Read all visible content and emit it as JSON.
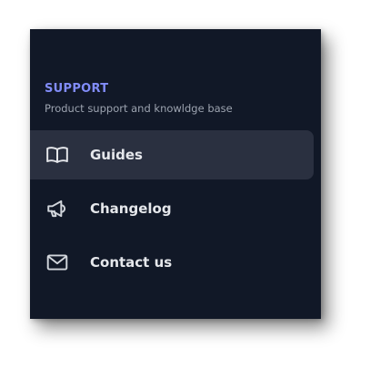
{
  "section": {
    "title": "SUPPORT",
    "subtitle": "Product support and knowldge base"
  },
  "nav": {
    "items": [
      {
        "label": "Guides",
        "icon": "book-open-icon",
        "active": true
      },
      {
        "label": "Changelog",
        "icon": "megaphone-icon",
        "active": false
      },
      {
        "label": "Contact us",
        "icon": "envelope-icon",
        "active": false
      }
    ]
  },
  "colors": {
    "panel_bg": "#111827",
    "active_bg": "#2a3040",
    "accent": "#818cf8",
    "subtitle": "#9ca3af",
    "label": "#e5e7eb"
  }
}
